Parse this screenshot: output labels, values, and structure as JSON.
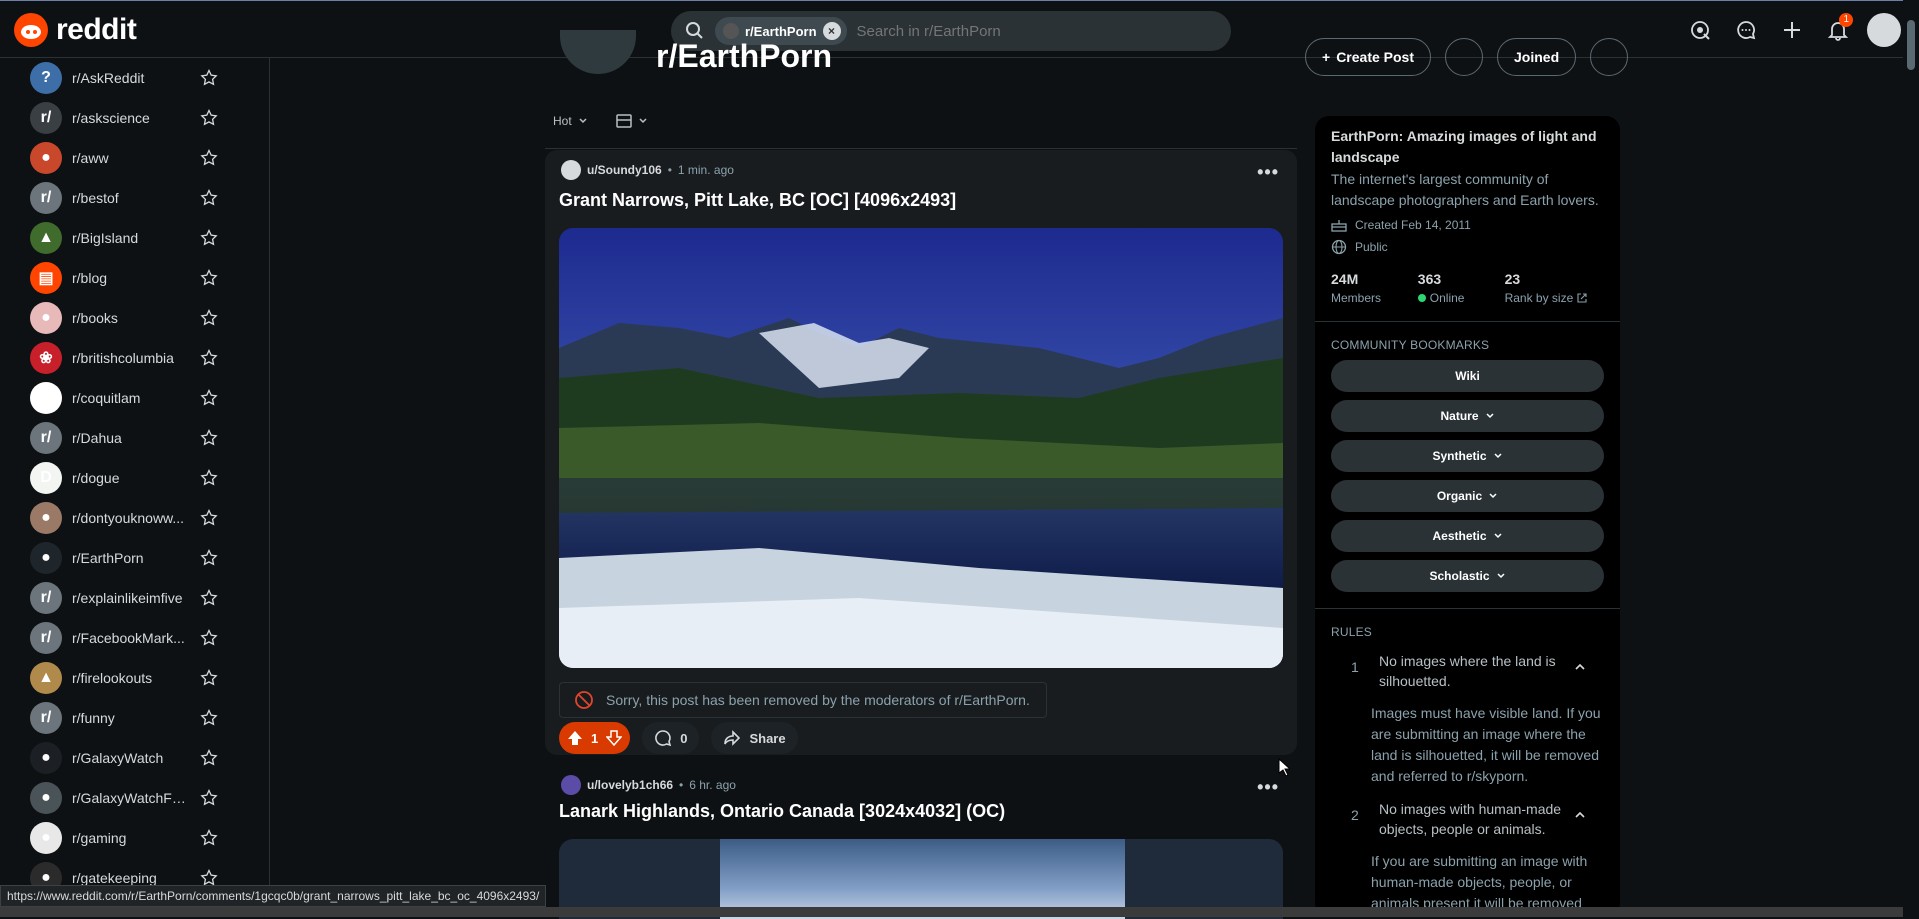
{
  "header": {
    "logo_text": "reddit",
    "search_chip": "r/EarthPorn",
    "search_placeholder": "Search in r/EarthPorn",
    "notification_count": "1"
  },
  "sidebar": {
    "items": [
      {
        "label": "r/AskReddit",
        "color": "#3d6ea8",
        "glyph": "?"
      },
      {
        "label": "r/askscience",
        "color": "#3a3f44",
        "glyph": "r/"
      },
      {
        "label": "r/aww",
        "color": "#c9482b",
        "glyph": "●"
      },
      {
        "label": "r/bestof",
        "color": "#6b757b",
        "glyph": "r/"
      },
      {
        "label": "r/BigIsland",
        "color": "#3f6b2d",
        "glyph": "▲"
      },
      {
        "label": "r/blog",
        "color": "#ff4500",
        "glyph": "▤"
      },
      {
        "label": "r/books",
        "color": "#e8b9b9",
        "glyph": "●"
      },
      {
        "label": "r/britishcolumbia",
        "color": "#c8202b",
        "glyph": "❀"
      },
      {
        "label": "r/coquitlam",
        "color": "#ffffff",
        "glyph": "·"
      },
      {
        "label": "r/Dahua",
        "color": "#6b757b",
        "glyph": "r/"
      },
      {
        "label": "r/dogue",
        "color": "#f2f5f2",
        "glyph": "D"
      },
      {
        "label": "r/dontyouknoww...",
        "color": "#9a7a66",
        "glyph": "●"
      },
      {
        "label": "r/EarthPorn",
        "color": "#1e262b",
        "glyph": "●"
      },
      {
        "label": "r/explainlikeimfive",
        "color": "#6b757b",
        "glyph": "r/"
      },
      {
        "label": "r/FacebookMark...",
        "color": "#6b757b",
        "glyph": "r/"
      },
      {
        "label": "r/firelookouts",
        "color": "#b08a4a",
        "glyph": "▲"
      },
      {
        "label": "r/funny",
        "color": "#6b757b",
        "glyph": "r/"
      },
      {
        "label": "r/GalaxyWatch",
        "color": "#1c2024",
        "glyph": "●"
      },
      {
        "label": "r/GalaxyWatchFa...",
        "color": "#4a5358",
        "glyph": "●"
      },
      {
        "label": "r/gaming",
        "color": "#e8e8e8",
        "glyph": "●"
      },
      {
        "label": "r/gatekeeping",
        "color": "#2b2b2b",
        "glyph": "●"
      }
    ]
  },
  "community": {
    "name": "r/EarthPorn",
    "create_post": "Create Post",
    "joined": "Joined"
  },
  "sort": {
    "label": "Hot"
  },
  "posts": [
    {
      "user": "u/Soundy106",
      "time": "1 min. ago",
      "title": "Grant Narrows, Pitt Lake, BC [OC] [4096x2493]",
      "removed_notice": "Sorry, this post has been removed by the moderators of r/EarthPorn.",
      "votes": "1",
      "comments": "0",
      "share": "Share"
    },
    {
      "user": "u/lovelyb1ch66",
      "time": "6 hr. ago",
      "title": "Lanark Highlands, Ontario Canada [3024x4032] (OC)"
    }
  ],
  "about": {
    "title": "EarthPorn: Amazing images of light and landscape",
    "description": "The internet's largest community of landscape photographers and Earth lovers.",
    "created": "Created Feb 14, 2011",
    "visibility": "Public",
    "members_num": "24M",
    "members_label": "Members",
    "online_num": "363",
    "online_label": "Online",
    "rank_num": "23",
    "rank_label": "Rank by size"
  },
  "bookmarks": {
    "heading": "COMMUNITY BOOKMARKS",
    "items": [
      "Wiki",
      "Nature",
      "Synthetic",
      "Organic",
      "Aesthetic",
      "Scholastic"
    ]
  },
  "rules": {
    "heading": "RULES",
    "items": [
      {
        "num": "1",
        "title": "No images where the land is silhouetted.",
        "body": "Images must have visible land. If you are submitting an image where the land is silhouetted, it will be removed and referred to r/skyporn."
      },
      {
        "num": "2",
        "title": "No images with human-made objects, people or animals.",
        "body": "If you are submitting an image with human-made objects, people, or animals present it will be removed"
      }
    ]
  },
  "status_url": "https://www.reddit.com/r/EarthPorn/comments/1gcqc0b/grant_narrows_pitt_lake_bc_oc_4096x2493/",
  "colors": {
    "accent": "#ff4500",
    "background": "#0e1113",
    "vote": "#d93a00"
  }
}
